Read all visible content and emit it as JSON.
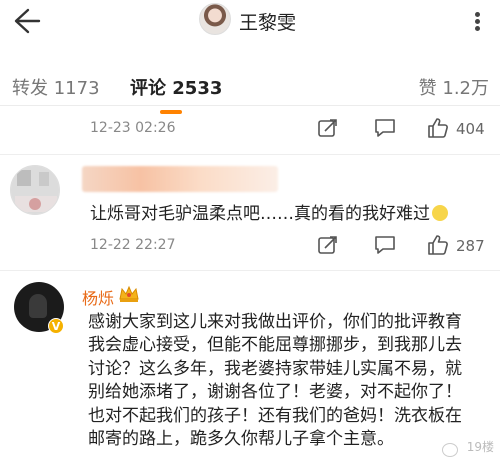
{
  "header": {
    "back_icon": "back-arrow-icon",
    "user_name": "王黎雯",
    "more_icon": "more-vertical-icon"
  },
  "tabs": {
    "repost": "转发 1173",
    "comment": "评论 2533",
    "like": "赞 1.2万",
    "active_color": "#ff8200"
  },
  "comments": [
    {
      "time": "12-23 02:26",
      "like_count": "404"
    },
    {
      "text": "让烁哥对毛驴温柔点吧……真的看的我好难过",
      "emoji": "smile-emoji-icon",
      "time": "12-22 22:27",
      "like_count": "287"
    },
    {
      "user": "杨烁",
      "badge": "crown-icon",
      "verified": "V",
      "lines": [
        "感谢大家到这儿来对我做出评价，你们的批评教育",
        "我会虚心接受，但能不能屈尊挪挪步，到我那儿去",
        "讨论？这么多年，我老婆持家带娃儿实属不易，就",
        "别给她添堵了，谢谢各位了！老婆，对不起你了！",
        "也对不起我们的孩子！还有我们的爸妈！洗衣板在",
        "邮寄的路上，跪多久你帮儿子拿个主意。"
      ]
    }
  ],
  "watermark": "19楼",
  "colors": {
    "username_orange": "#e86a17",
    "verified_badge": "#f5b100"
  }
}
